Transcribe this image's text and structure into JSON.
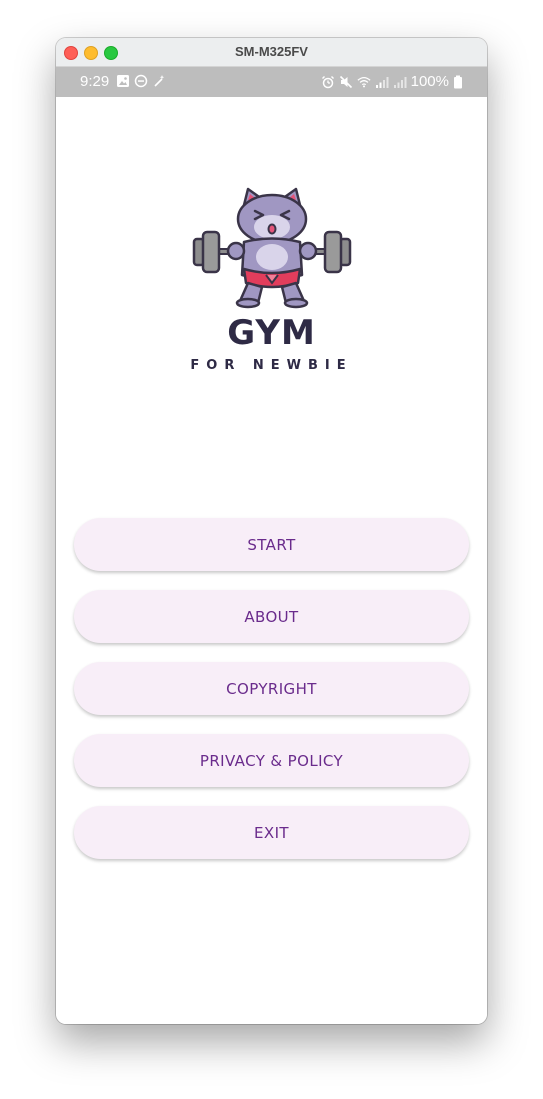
{
  "window": {
    "title": "SM-M325FV"
  },
  "status_bar": {
    "time": "9:29",
    "battery": "100%",
    "left_icons": [
      "image-icon",
      "dnd-icon",
      "magic-wand-icon"
    ],
    "right_icons": [
      "alarm-icon",
      "mute-icon",
      "wifi-icon",
      "signal-icon",
      "signal-icon",
      "battery-icon"
    ]
  },
  "brand": {
    "title": "GYM",
    "subtitle": "FOR NEWBIE"
  },
  "menu": {
    "start": "START",
    "about": "ABOUT",
    "copyright": "COPYRIGHT",
    "privacy": "PRIVACY & POLICY",
    "exit": "EXIT"
  },
  "colors": {
    "button_bg": "#f8eef8",
    "button_text": "#6a2b8c",
    "status_bar": "#bdbdbd",
    "brand_text": "#2e2a45"
  }
}
